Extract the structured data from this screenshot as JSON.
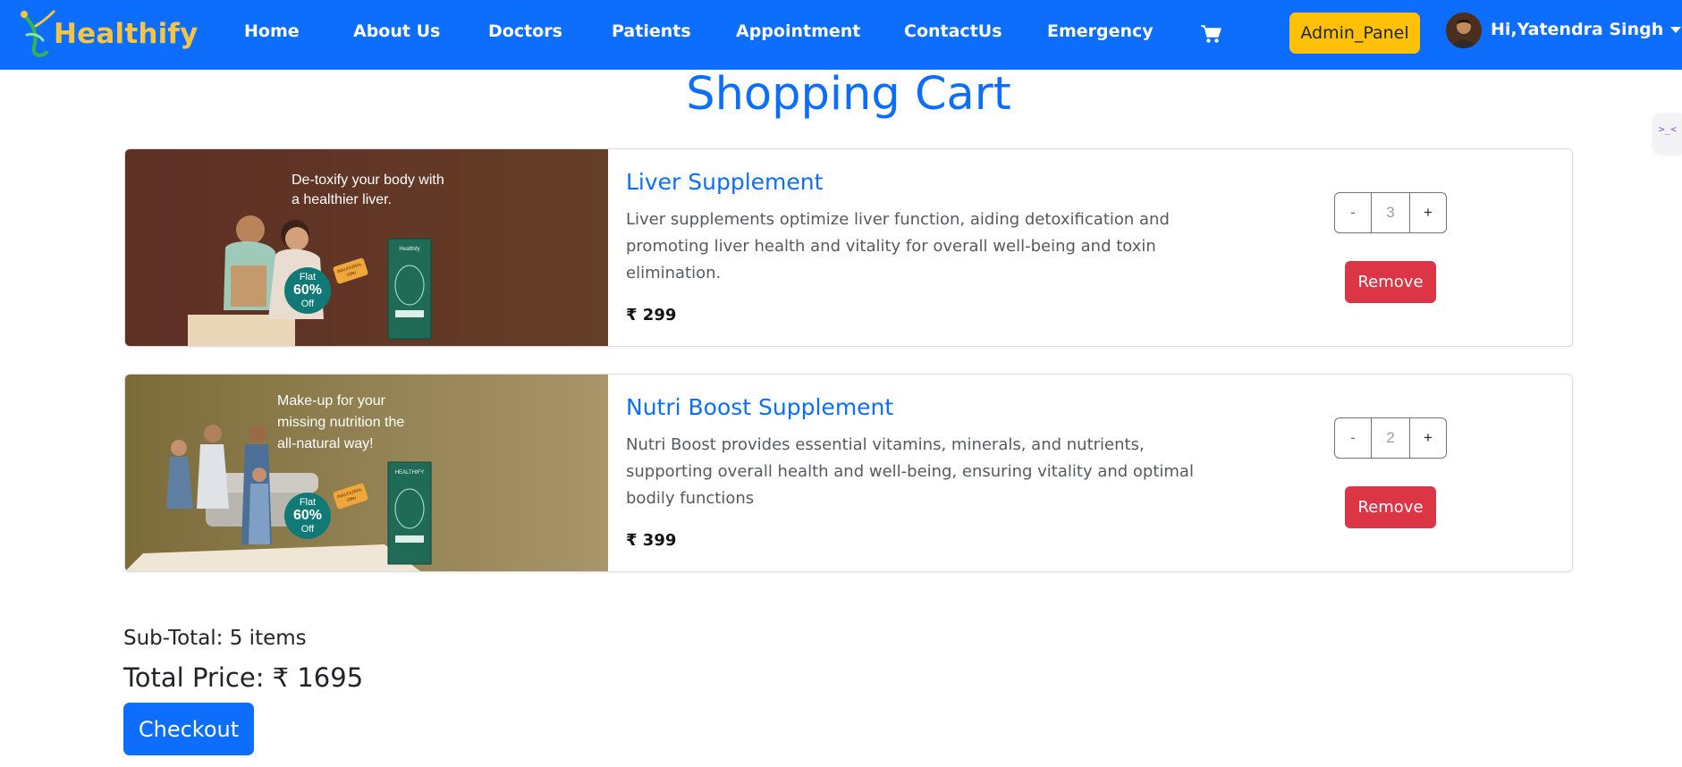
{
  "navbar": {
    "brand": "Healthify",
    "links": [
      "Home",
      "About Us",
      "Doctors",
      "Patients",
      "Appointment",
      "ContactUs",
      "Emergency"
    ],
    "cart_icon": "shopping-cart-icon",
    "admin_button": "Admin_Panel",
    "user_greeting": "Hi,Yatendra Singh",
    "colors": {
      "bar": "#0d6efd",
      "brand": "#f4c542",
      "admin": "#ffc107"
    }
  },
  "side_widget": {
    "text": ">_<"
  },
  "page": {
    "title": "Shopping Cart"
  },
  "items": [
    {
      "name": "Liver Supplement",
      "description": "Liver supplements optimize liver function, aiding detoxification and promoting liver health and vitality for overall well-being and toxin elimination.",
      "price": "₹ 299",
      "quantity": "3",
      "minus": "-",
      "plus": "+",
      "remove_label": "Remove",
      "banner": {
        "headline_1": "De-toxify your body with",
        "headline_2": "a healthier liver.",
        "offer_1": "Flat",
        "offer_2": "60%",
        "offer_3": "Off",
        "tag_1": "INAUGURAL",
        "tag_2": "Offer",
        "pack_brand": "Healthify",
        "bg": "#6a3a2a"
      }
    },
    {
      "name": "Nutri Boost Supplement",
      "description": "Nutri Boost provides essential vitamins, minerals, and nutrients, supporting overall health and well-being, ensuring vitality and optimal bodily functions",
      "price": "₹ 399",
      "quantity": "2",
      "minus": "-",
      "plus": "+",
      "remove_label": "Remove",
      "banner": {
        "headline_1": "Make-up for your",
        "headline_2": "missing nutrition the",
        "headline_3": "all-natural way!",
        "offer_1": "Flat",
        "offer_2": "60%",
        "offer_3": "Off",
        "tag_1": "INAUGURAL",
        "tag_2": "Offer",
        "pack_brand": "HEALTHIFY",
        "bg": "#8a7a4a"
      }
    }
  ],
  "summary": {
    "subtotal": "Sub-Total: 5 items",
    "total": "Total Price: ₹ 1695",
    "checkout_label": "Checkout"
  },
  "colors": {
    "primary": "#0d6efd",
    "danger": "#dc3545"
  }
}
